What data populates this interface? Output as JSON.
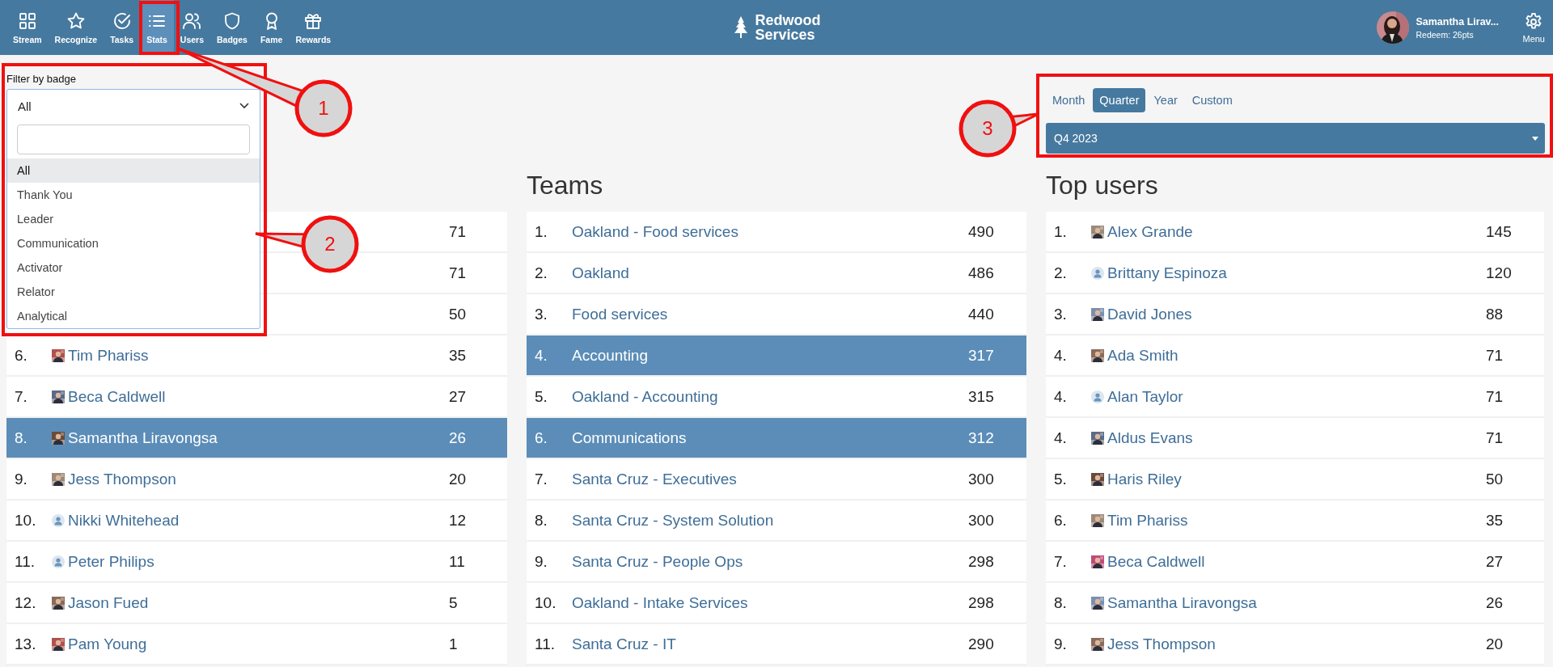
{
  "nav": {
    "items": [
      {
        "label": "Stream",
        "selected": false
      },
      {
        "label": "Recognize",
        "selected": false
      },
      {
        "label": "Tasks",
        "selected": false
      },
      {
        "label": "Stats",
        "selected": true
      },
      {
        "label": "Users",
        "selected": false
      },
      {
        "label": "Badges",
        "selected": false
      },
      {
        "label": "Fame",
        "selected": false
      },
      {
        "label": "Rewards",
        "selected": false
      }
    ],
    "logo": [
      "Redwood",
      "Services"
    ],
    "user": {
      "name": "Samantha Lirav...",
      "points": "Redeem: 26pts"
    },
    "menu": "Menu"
  },
  "filter": {
    "label": "Filter by badge",
    "value": "All",
    "options": [
      {
        "label": "All",
        "selected": true
      },
      {
        "label": "Thank You",
        "selected": false
      },
      {
        "label": "Leader",
        "selected": false
      },
      {
        "label": "Communication",
        "selected": false
      },
      {
        "label": "Activator",
        "selected": false
      },
      {
        "label": "Relator",
        "selected": false
      },
      {
        "label": "Analytical",
        "selected": false
      }
    ]
  },
  "period": {
    "tabs": [
      {
        "label": "Month",
        "selected": false
      },
      {
        "label": "Quarter",
        "selected": true
      },
      {
        "label": "Year",
        "selected": false
      },
      {
        "label": "Custom",
        "selected": false
      }
    ],
    "value": "Q4 2023"
  },
  "columns": [
    {
      "rows": [
        {
          "score": "71",
          "selected": false
        },
        {
          "score": "71",
          "selected": false
        },
        {
          "score": "50",
          "selected": false
        },
        {
          "rank": "6.",
          "name": "Tim Phariss",
          "score": "35",
          "selected": false
        },
        {
          "rank": "7.",
          "name": "Beca Caldwell",
          "score": "27",
          "selected": false
        },
        {
          "rank": "8.",
          "name": "Samantha Liravongsa",
          "score": "26",
          "selected": true
        },
        {
          "rank": "9.",
          "name": "Jess Thompson",
          "score": "20",
          "selected": false
        },
        {
          "rank": "10.",
          "name": "Nikki Whitehead",
          "kind": "default",
          "score": "12",
          "selected": false
        },
        {
          "rank": "11.",
          "name": "Peter Philips",
          "kind": "default",
          "score": "11",
          "selected": false
        },
        {
          "rank": "12.",
          "name": "Jason Fued",
          "score": "5",
          "selected": false
        },
        {
          "rank": "13.",
          "name": "Pam Young",
          "score": "1",
          "selected": false
        }
      ]
    },
    {
      "title": "Teams",
      "rows": [
        {
          "rank": "1.",
          "name": "Oakland - Food services",
          "score": "490",
          "selected": false
        },
        {
          "rank": "2.",
          "name": "Oakland",
          "score": "486",
          "selected": false
        },
        {
          "rank": "3.",
          "name": "Food services",
          "score": "440",
          "selected": false
        },
        {
          "rank": "4.",
          "name": "Accounting",
          "score": "317",
          "selected": true
        },
        {
          "rank": "5.",
          "name": "Oakland - Accounting",
          "score": "315",
          "selected": false
        },
        {
          "rank": "6.",
          "name": "Communications",
          "score": "312",
          "selected": true
        },
        {
          "rank": "7.",
          "name": "Santa Cruz - Executives",
          "score": "300",
          "selected": false
        },
        {
          "rank": "8.",
          "name": "Santa Cruz - System Solution",
          "score": "300",
          "selected": false
        },
        {
          "rank": "9.",
          "name": "Santa Cruz - People Ops",
          "score": "298",
          "selected": false
        },
        {
          "rank": "10.",
          "name": "Oakland - Intake Services",
          "score": "298",
          "selected": false
        },
        {
          "rank": "11.",
          "name": "Santa Cruz - IT",
          "score": "290",
          "selected": false
        }
      ]
    },
    {
      "title": "Top users",
      "rows": [
        {
          "rank": "1.",
          "name": "Alex Grande",
          "score": "145",
          "selected": false
        },
        {
          "rank": "2.",
          "name": "Brittany Espinoza",
          "kind": "default",
          "score": "120",
          "selected": false
        },
        {
          "rank": "3.",
          "name": "David Jones",
          "score": "88",
          "selected": false
        },
        {
          "rank": "4.",
          "name": "Ada Smith",
          "score": "71",
          "selected": false
        },
        {
          "rank": "4.",
          "name": "Alan Taylor",
          "kind": "default",
          "score": "71",
          "selected": false
        },
        {
          "rank": "4.",
          "name": "Aldus Evans",
          "score": "71",
          "selected": false
        },
        {
          "rank": "5.",
          "name": "Haris Riley",
          "score": "50",
          "selected": false
        },
        {
          "rank": "6.",
          "name": "Tim Phariss",
          "score": "35",
          "selected": false
        },
        {
          "rank": "7.",
          "name": "Beca Caldwell",
          "score": "27",
          "selected": false
        },
        {
          "rank": "8.",
          "name": "Samantha Liravongsa",
          "score": "26",
          "selected": false
        },
        {
          "rank": "9.",
          "name": "Jess Thompson",
          "score": "20",
          "selected": false
        }
      ]
    }
  ],
  "callouts": [
    {
      "number": "1"
    },
    {
      "number": "2"
    },
    {
      "number": "3"
    }
  ]
}
